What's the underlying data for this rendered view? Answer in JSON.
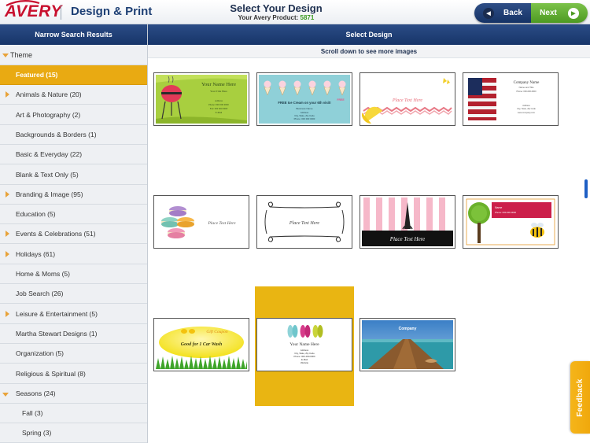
{
  "header": {
    "logo_text": "AVERY",
    "brand": "Design & Print",
    "title": "Select Your Design",
    "product_label": "Your Avery Product:",
    "product_number": "5871",
    "back_label": "Back",
    "next_label": "Next"
  },
  "sidebar": {
    "title": "Narrow Search Results",
    "section": "Theme",
    "items": [
      {
        "label": "Featured  (15)",
        "expandable": false,
        "selected": true
      },
      {
        "label": "Animals & Nature  (20)",
        "expandable": true
      },
      {
        "label": "Art & Photography  (2)",
        "expandable": false
      },
      {
        "label": "Backgrounds & Borders  (1)",
        "expandable": false
      },
      {
        "label": "Basic & Everyday  (22)",
        "expandable": false
      },
      {
        "label": "Blank & Text Only  (5)",
        "expandable": false
      },
      {
        "label": "Branding & Image  (95)",
        "expandable": true
      },
      {
        "label": "Education  (5)",
        "expandable": false
      },
      {
        "label": "Events & Celebrations  (51)",
        "expandable": true
      },
      {
        "label": "Holidays  (61)",
        "expandable": true
      },
      {
        "label": "Home & Moms  (5)",
        "expandable": false
      },
      {
        "label": "Job Search  (26)",
        "expandable": false
      },
      {
        "label": "Leisure & Entertainment  (5)",
        "expandable": true
      },
      {
        "label": "Martha Stewart Designs  (1)",
        "expandable": false
      },
      {
        "label": "Organization  (5)",
        "expandable": false
      },
      {
        "label": "Religious & Spiritual  (8)",
        "expandable": false
      },
      {
        "label": "Seasons  (24)",
        "expandable": true,
        "expanded": true
      },
      {
        "label": "Fall  (3)",
        "sub": true
      },
      {
        "label": "Spring  (3)",
        "sub": true
      }
    ]
  },
  "main": {
    "title": "Select Design",
    "scroll_hint": "Scroll down to see more images",
    "feedback_label": "Feedback",
    "cards": [
      {
        "texts": [
          "Your Name Here",
          "Your Title Here",
          "Address",
          "Phone: 000 000 0000",
          "Fax: 000 000 0000",
          "E-Mail"
        ]
      },
      {
        "texts": [
          "FREE Ice Cream on your 6th visit!",
          "Business Name",
          "Address",
          "City, State, Zip Code",
          "Phone: 000 000 0000",
          "FREE"
        ]
      },
      {
        "texts": [
          "Place Text Here"
        ]
      },
      {
        "texts": [
          "Company Name",
          "Name and Title",
          "Phone: 000-000-0000",
          "Address",
          "City, State, Zip Code",
          "www.company.com"
        ]
      },
      {
        "texts": [
          "Place Text Here"
        ]
      },
      {
        "texts": [
          "Place Text Here"
        ]
      },
      {
        "texts": [
          "Place Text Here"
        ]
      },
      {
        "texts": [
          "Name",
          "Phone: 000-000-0000"
        ]
      },
      {
        "texts": [
          "Gift Coupon",
          "Good for 1 Car Wash"
        ]
      },
      {
        "texts": [
          "Your Name Here",
          "Address",
          "City, State, Zip Code",
          "Phone: 000-000-0000",
          "E-Mail",
          "Website"
        ]
      },
      {
        "texts": [
          "Company"
        ]
      }
    ],
    "colors": {
      "accent_selected": "#e9b512",
      "header_navy": "#1d3f74",
      "next_green": "#5aaa2a"
    }
  }
}
